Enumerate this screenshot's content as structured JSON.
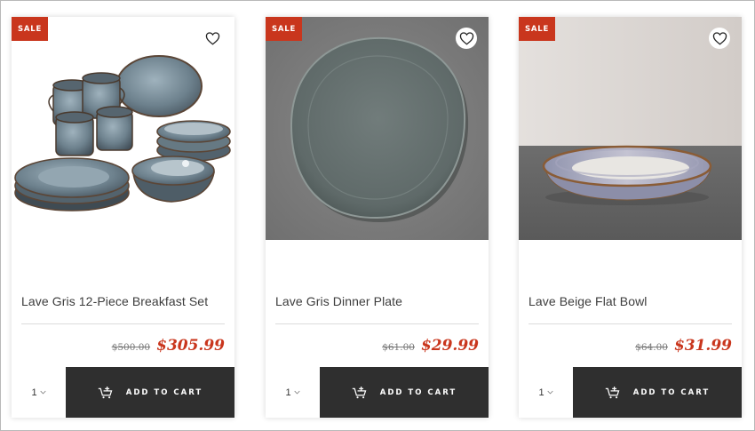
{
  "products": [
    {
      "badge": "SALE",
      "name": "Lave Gris 12-Piece Breakfast Set",
      "old_price": "$500.00",
      "price": "$305.99",
      "quantity": "1",
      "cart_label": "ADD TO CART"
    },
    {
      "badge": "SALE",
      "name": "Lave Gris Dinner Plate",
      "old_price": "$61.00",
      "price": "$29.99",
      "quantity": "1",
      "cart_label": "ADD TO CART"
    },
    {
      "badge": "SALE",
      "name": "Lave Beige Flat Bowl",
      "old_price": "$64.00",
      "price": "$31.99",
      "quantity": "1",
      "cart_label": "ADD TO CART"
    }
  ],
  "colors": {
    "sale_red": "#c9361d",
    "cart_dark": "#2f2f2f",
    "text": "#3c3c3c"
  },
  "icons": [
    "heart-icon",
    "cart-plus-icon",
    "chevron-down-icon"
  ]
}
